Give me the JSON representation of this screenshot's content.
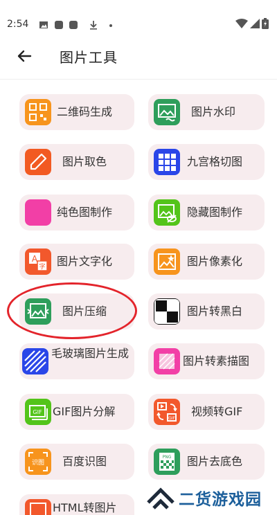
{
  "status_bar": {
    "time": "2:54"
  },
  "app_bar": {
    "title": "图片工具"
  },
  "tools": [
    {
      "label": "二维码生成",
      "icon": "qr-code-icon",
      "color": "#f7941d"
    },
    {
      "label": "图片水印",
      "icon": "image-watermark-icon",
      "color": "#2e9e5b"
    },
    {
      "label": "图片取色",
      "icon": "eyedropper-icon",
      "color": "#f25a22"
    },
    {
      "label": "九宫格切图",
      "icon": "grid-nine-icon",
      "color": "#2a46e8"
    },
    {
      "label": "纯色图制作",
      "icon": "solid-color-icon",
      "color": "#f23fa6"
    },
    {
      "label": "隐藏图制作",
      "icon": "hidden-image-icon",
      "color": "#53c41a"
    },
    {
      "label": "图片文字化",
      "icon": "image-to-text-icon",
      "color": "#f2582c"
    },
    {
      "label": "图片像素化",
      "icon": "pixelate-icon",
      "color": "#f7941d"
    },
    {
      "label": "图片压缩",
      "icon": "image-compress-icon",
      "color": "#2e9e5b"
    },
    {
      "label": "图片转黑白",
      "icon": "black-white-icon",
      "color": "#111111"
    },
    {
      "label": "毛玻璃图片生成",
      "icon": "frosted-glass-icon",
      "color": "#2a46e8"
    },
    {
      "label": "图片转素描图",
      "icon": "sketch-icon",
      "color": "#f23fa6"
    },
    {
      "label": "GIF图片分解",
      "icon": "gif-split-icon",
      "color": "#53c41a"
    },
    {
      "label": "视频转GIF",
      "icon": "video-to-gif-icon",
      "color": "#f2582c"
    },
    {
      "label": "百度识图",
      "icon": "image-recognition-icon",
      "color": "#f7941d"
    },
    {
      "label": "图片去底色",
      "icon": "remove-background-icon",
      "color": "#2e9e5b"
    },
    {
      "label": "HTML转图片",
      "icon": "html-to-image-icon",
      "color": "#f2582c"
    }
  ],
  "watermark": {
    "text": "二货游戏园"
  }
}
